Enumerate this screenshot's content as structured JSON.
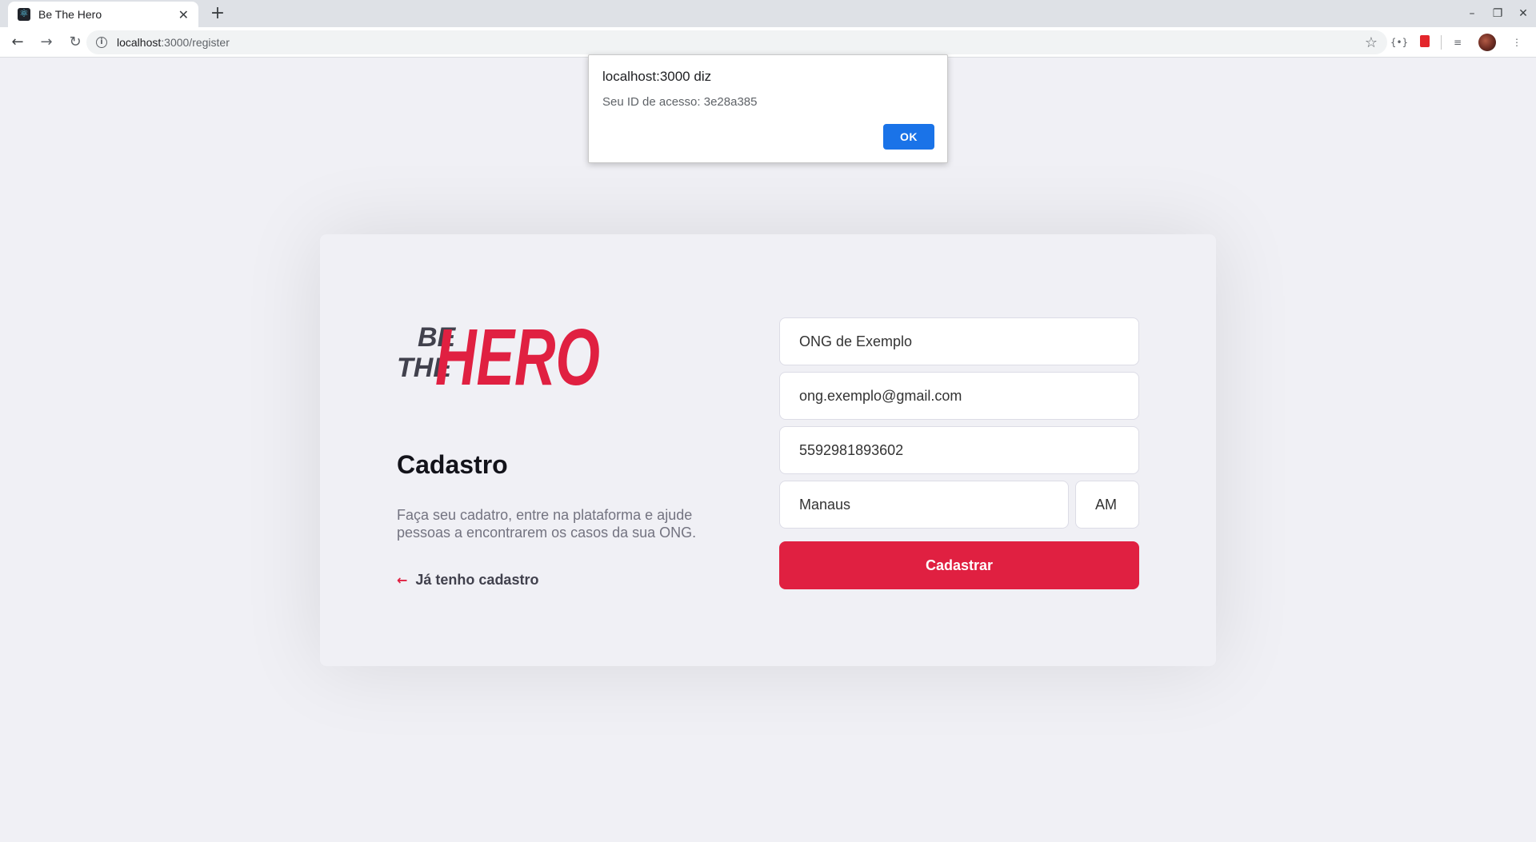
{
  "browser": {
    "tab_title": "Be The Hero",
    "tab_favicon": "react-icon",
    "url_host": "localhost",
    "url_path": ":3000/register",
    "colors": {
      "tabbar": "#dee1e6",
      "omnibox": "#f1f3f4",
      "office": "#e3262b"
    }
  },
  "page": {
    "logo_text": {
      "line1": "BE",
      "line2": "THE",
      "big": "HERO"
    },
    "title": "Cadastro",
    "description": "Faça seu cadatro, entre na plataforma e ajude pessoas a encontrarem os casos da sua ONG.",
    "back_link": "Já tenho cadastro",
    "form": {
      "name": "ONG de Exemplo",
      "email": "ong.exemplo@gmail.com",
      "whatsapp": "5592981893602",
      "city": "Manaus",
      "uf": "AM"
    },
    "submit_label": "Cadastrar",
    "colors": {
      "accent": "#e02041",
      "logo_dark": "#41414d",
      "text": "#13131a",
      "muted": "#737380",
      "background": "#f0f0f5"
    }
  },
  "alert": {
    "title": "localhost:3000 diz",
    "message": "Seu ID de acesso: 3e28a385",
    "ok_label": "OK",
    "colors": {
      "button": "#1a73e8"
    }
  }
}
